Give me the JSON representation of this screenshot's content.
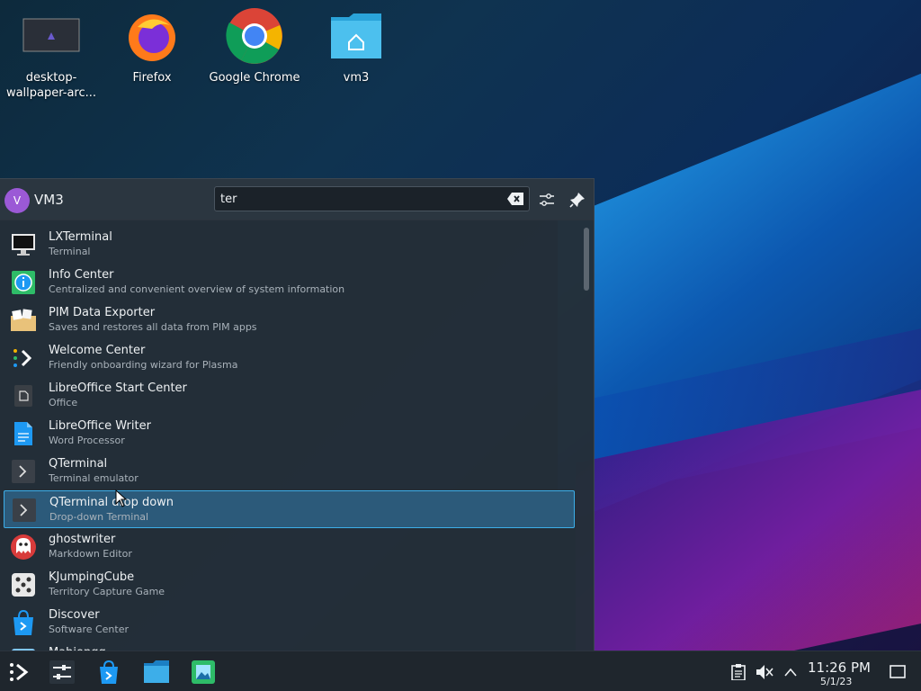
{
  "desktop": {
    "icons": [
      {
        "label": "desktop-wallpaper-arc..."
      },
      {
        "label": "Firefox"
      },
      {
        "label": "Google Chrome"
      },
      {
        "label": "vm3"
      }
    ]
  },
  "launcher": {
    "user": {
      "initial": "V",
      "name": "VM3"
    },
    "search": {
      "value": "ter"
    },
    "results": [
      {
        "name": "LXTerminal",
        "desc": "Terminal",
        "icon": "monitor-icon"
      },
      {
        "name": "Info Center",
        "desc": "Centralized and convenient overview of system information",
        "icon": "info-icon"
      },
      {
        "name": "PIM Data Exporter",
        "desc": "Saves and restores all data from PIM apps",
        "icon": "archive-icon"
      },
      {
        "name": "Welcome Center",
        "desc": "Friendly onboarding wizard for Plasma",
        "icon": "welcome-icon"
      },
      {
        "name": "LibreOffice Start Center",
        "desc": "Office",
        "icon": "libreoffice-icon"
      },
      {
        "name": "LibreOffice Writer",
        "desc": "Word Processor",
        "icon": "writer-icon"
      },
      {
        "name": "QTerminal",
        "desc": "Terminal emulator",
        "icon": "terminal-icon"
      },
      {
        "name": "QTerminal drop down",
        "desc": "Drop-down Terminal",
        "icon": "terminal-icon"
      },
      {
        "name": "ghostwriter",
        "desc": "Markdown Editor",
        "icon": "ghost-icon"
      },
      {
        "name": "KJumpingCube",
        "desc": "Territory Capture Game",
        "icon": "dice-icon"
      },
      {
        "name": "Discover",
        "desc": "Software Center",
        "icon": "store-icon"
      },
      {
        "name": "Mahjongg",
        "desc": "",
        "icon": "partial-icon"
      }
    ],
    "selected_index": 7
  },
  "taskbar": {
    "clock": {
      "time": "11:26 PM",
      "date": "5/1/23"
    }
  },
  "colors": {
    "accent": "#3daee9",
    "panel": "#242e38",
    "taskbar": "#1f262d"
  }
}
